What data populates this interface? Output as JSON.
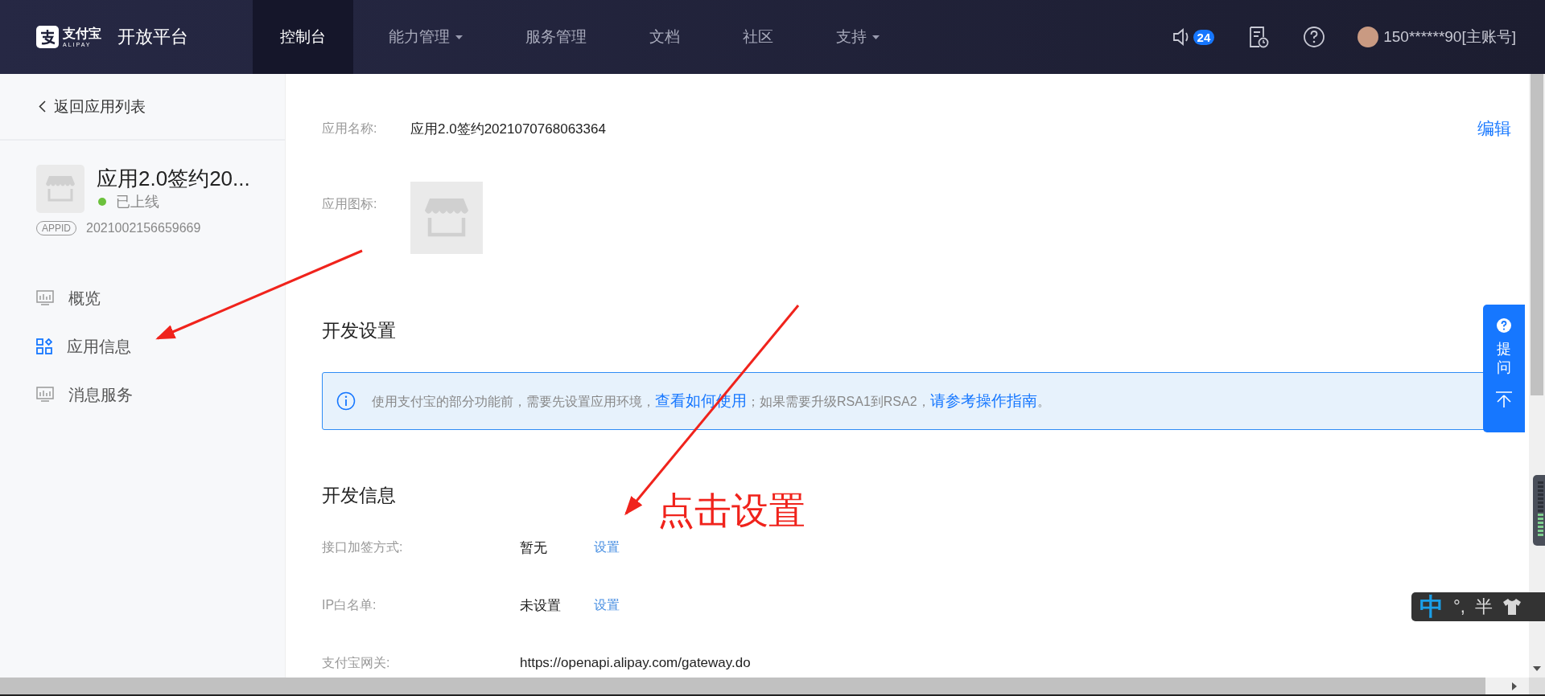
{
  "topbar": {
    "logo_text": "支付宝",
    "logo_sub": "ALIPAY",
    "platform": "开放平台",
    "nav": [
      {
        "label": "控制台",
        "selected": true,
        "dropdown": false
      },
      {
        "label": "能力管理",
        "selected": false,
        "dropdown": true
      },
      {
        "label": "服务管理",
        "selected": false,
        "dropdown": false
      },
      {
        "label": "文档",
        "selected": false,
        "dropdown": false
      },
      {
        "label": "社区",
        "selected": false,
        "dropdown": false
      },
      {
        "label": "支持",
        "selected": false,
        "dropdown": true
      }
    ],
    "notification_count": "24",
    "account": "150******90[主账号]"
  },
  "sidebar": {
    "back": "返回应用列表",
    "app": {
      "name": "应用2.0签约20...",
      "status": "已上线",
      "appid_tag": "APPID",
      "appid": "2021002156659669"
    },
    "menu": [
      {
        "label": "概览",
        "selected": false,
        "kind": "chart"
      },
      {
        "label": "应用信息",
        "selected": true,
        "kind": "grid"
      },
      {
        "label": "消息服务",
        "selected": false,
        "kind": "chart"
      }
    ]
  },
  "main": {
    "name_label": "应用名称:",
    "name_value": "应用2.0签约2021070768063364",
    "edit": "编辑",
    "icon_label": "应用图标:",
    "settings_title": "开发设置",
    "notice": [
      {
        "kind": "text",
        "text": "使用支付宝的部分功能前，需要先设置应用环境，"
      },
      {
        "kind": "link",
        "text": "查看如何使用"
      },
      {
        "kind": "text",
        "text": "；如果需要升级RSA1到RSA2，"
      },
      {
        "kind": "link",
        "text": "请参考操作指南"
      },
      {
        "kind": "text",
        "text": "。"
      }
    ],
    "info_title": "开发信息",
    "info_rows": [
      {
        "label": "接口加签方式:",
        "value": "暂无",
        "action": "设置"
      },
      {
        "label": "IP白名单:",
        "value": "未设置",
        "action": "设置"
      },
      {
        "label": "支付宝网关:",
        "value": "https://openapi.alipay.com/gateway.do"
      }
    ]
  },
  "help_widget": {
    "label": "提问"
  },
  "ime_bar": {
    "mode": "中",
    "punct": "°,",
    "width": "半"
  },
  "annotation": {
    "text": "点击设置"
  }
}
